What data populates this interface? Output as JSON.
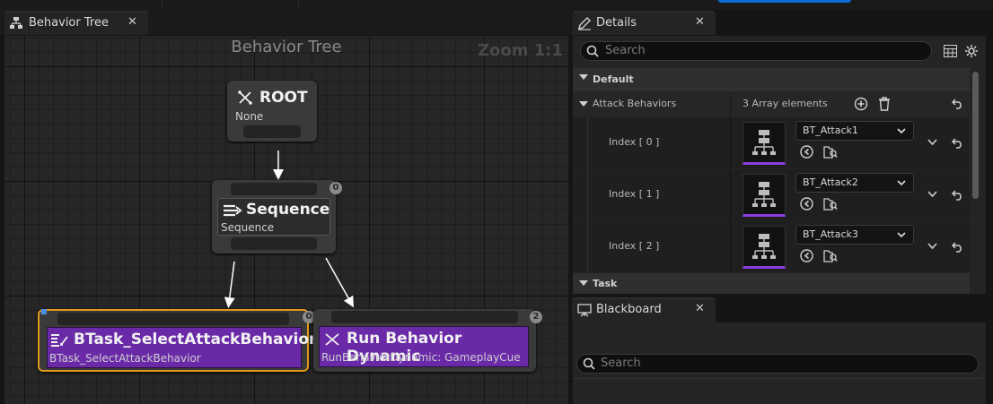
{
  "left_tab": {
    "title": "Behavior Tree",
    "icon": "behavior-tree-icon"
  },
  "graph": {
    "title": "Behavior Tree",
    "zoom": "Zoom 1:1",
    "nodes": {
      "root": {
        "title": "ROOT",
        "subtitle": "None",
        "icon": "root-icon"
      },
      "sequence": {
        "title": "Sequence",
        "subtitle": "Sequence",
        "badge": "0",
        "icon": "sequence-icon"
      },
      "task1": {
        "title": "BTask_SelectAttackBehavior",
        "subtitle": "BTask_SelectAttackBehavior",
        "badge": "0",
        "icon": "task-icon"
      },
      "task2": {
        "title": "Run Behavior Dynamic",
        "subtitle": "RunBehaviorDynamic: GameplayCue",
        "badge": "2",
        "icon": "run-behavior-icon"
      }
    }
  },
  "details": {
    "tab_title": "Details",
    "search_placeholder": "Search",
    "section_default": "Default",
    "attack_label": "Attack Behaviors",
    "array_count": "3 Array elements",
    "elements": [
      {
        "index": "Index [ 0 ]",
        "value": "BT_Attack1"
      },
      {
        "index": "Index [ 1 ]",
        "value": "BT_Attack2"
      },
      {
        "index": "Index [ 2 ]",
        "value": "BT_Attack3"
      }
    ],
    "section_task": "Task"
  },
  "blackboard": {
    "tab_title": "Blackboard",
    "search_placeholder": "Search"
  },
  "colors": {
    "accent_blue": "#0e6bd6",
    "task_purple": "#6a2aa8",
    "selection_orange": "#e09a1c",
    "thumb_underline": "#8a3ee0"
  }
}
